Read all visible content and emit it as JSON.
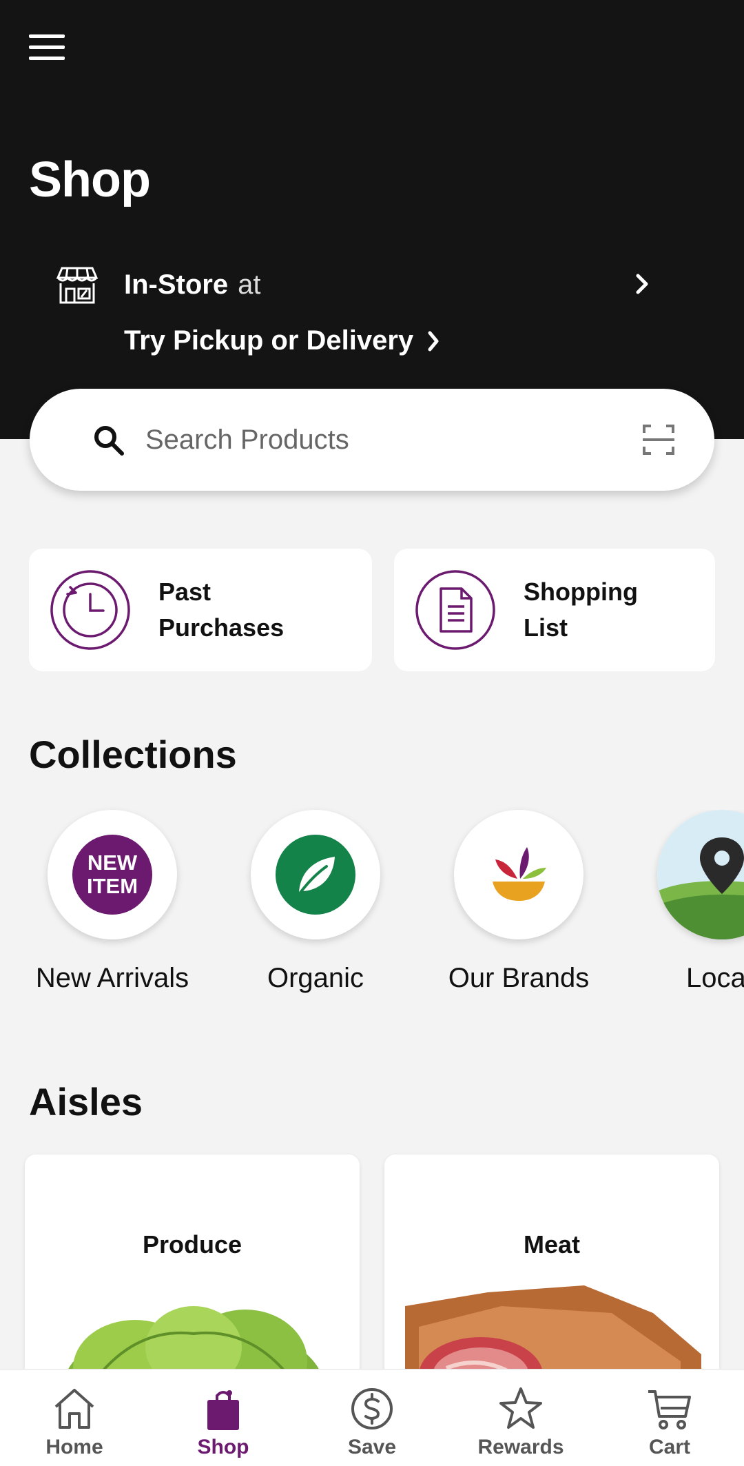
{
  "header": {
    "title": "Shop",
    "store_mode": "In-Store",
    "store_at": "at",
    "pickup_link": "Try Pickup or Delivery"
  },
  "search": {
    "placeholder": "Search Products"
  },
  "quick_actions": [
    {
      "label_line1": "Past",
      "label_line2": "Purchases",
      "icon": "clock-history-icon"
    },
    {
      "label_line1": "Shopping",
      "label_line2": "List",
      "icon": "document-list-icon"
    }
  ],
  "collections": {
    "title": "Collections",
    "items": [
      {
        "label": "New Arrivals",
        "badge_line1": "NEW",
        "badge_line2": "ITEM"
      },
      {
        "label": "Organic"
      },
      {
        "label": "Our Brands"
      },
      {
        "label": "Loca"
      }
    ]
  },
  "aisles": {
    "title": "Aisles",
    "items": [
      {
        "label": "Produce"
      },
      {
        "label": "Meat"
      }
    ]
  },
  "bottom_nav": {
    "items": [
      {
        "label": "Home",
        "icon": "home-icon",
        "active": false
      },
      {
        "label": "Shop",
        "icon": "shopping-bag-icon",
        "active": true
      },
      {
        "label": "Save",
        "icon": "dollar-circle-icon",
        "active": false
      },
      {
        "label": "Rewards",
        "icon": "star-icon",
        "active": false
      },
      {
        "label": "Cart",
        "icon": "cart-icon",
        "active": false
      }
    ]
  },
  "colors": {
    "header_bg": "#141414",
    "brand_purple": "#6c1a6f",
    "organic_green": "#14834a",
    "background": "#f3f3f3"
  }
}
